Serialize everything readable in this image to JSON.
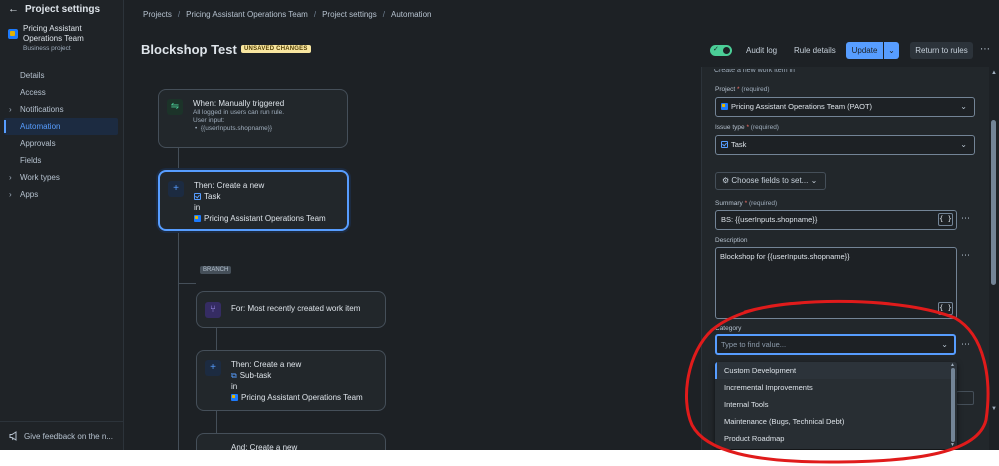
{
  "sidebar": {
    "header": "Project settings",
    "project_name": "Pricing Assistant Operations Team",
    "project_type": "Business project",
    "items": [
      {
        "label": "Details",
        "chevron": false,
        "active": false
      },
      {
        "label": "Access",
        "chevron": false,
        "active": false
      },
      {
        "label": "Notifications",
        "chevron": true,
        "active": false
      },
      {
        "label": "Automation",
        "chevron": false,
        "active": true
      },
      {
        "label": "Approvals",
        "chevron": false,
        "active": false
      },
      {
        "label": "Fields",
        "chevron": false,
        "active": false
      },
      {
        "label": "Work types",
        "chevron": true,
        "active": false
      },
      {
        "label": "Apps",
        "chevron": true,
        "active": false
      }
    ],
    "feedback": "Give feedback on the n..."
  },
  "breadcrumbs": [
    "Projects",
    "Pricing Assistant Operations Team",
    "Project settings",
    "Automation"
  ],
  "header": {
    "title": "Blockshop Test",
    "badge": "UNSAVED CHANGES",
    "audit_log": "Audit log",
    "rule_details": "Rule details",
    "update": "Update",
    "return": "Return to rules"
  },
  "canvas": {
    "trigger": {
      "title": "When: Manually triggered",
      "line1": "All logged in users can run rule.",
      "line2": "User input:",
      "line3": "{{userInputs.shopname}}"
    },
    "action1": {
      "title": "Then: Create a new",
      "type": "Task",
      "in": "in",
      "project": "Pricing Assistant Operations Team"
    },
    "branch_tag": "BRANCH",
    "branch": {
      "title": "For: Most recently created work item"
    },
    "action2": {
      "title": "Then: Create a new",
      "type": "Sub-task",
      "in": "in",
      "project": "Pricing Assistant Operations Team"
    },
    "action3": {
      "title": "And: Create a new"
    }
  },
  "panel": {
    "cut_heading": "Create a new work item in",
    "project_label": "Project",
    "required_hint": "(required)",
    "project_value": "Pricing Assistant Operations Team (PAOT)",
    "issue_type_label": "Issue type",
    "issue_type_value": "Task",
    "choose_fields": "Choose fields to set...",
    "summary_label": "Summary",
    "summary_value": "BS: {{userInputs.shopname}}",
    "description_label": "Description",
    "description_value": "Blockshop for {{userInputs.shopname}}",
    "category_label": "Category",
    "category_placeholder": "Type to find value...",
    "smart_value_btn": "{ }",
    "category_options": [
      "Custom Development",
      "Incremental Improvements",
      "Internal Tools",
      "Maintenance (Bugs, Technical Debt)",
      "Product Roadmap"
    ]
  },
  "colors": {
    "background": "#1d2125",
    "accent": "#579dff",
    "annotation": "#e01b1b",
    "badge": "#f8e6a0"
  }
}
